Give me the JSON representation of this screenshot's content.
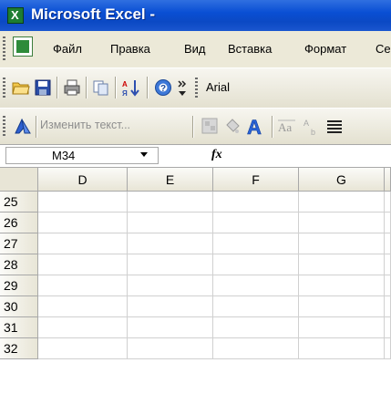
{
  "window": {
    "title": "Microsoft Excel -"
  },
  "menu": {
    "items": [
      {
        "label": "Файл"
      },
      {
        "label": "Правка"
      },
      {
        "label": "Вид"
      },
      {
        "label": "Вставка"
      },
      {
        "label": "Формат"
      },
      {
        "label": "Се"
      }
    ]
  },
  "toolbar": {
    "font": "Arial",
    "icons": [
      "open-folder-icon",
      "save-icon",
      "print-icon",
      "copy-icon",
      "sort-ascending-icon",
      "help-icon"
    ]
  },
  "toolbar2": {
    "edit_text_label": "Изменить текст..."
  },
  "formula_bar": {
    "name_box": "M34",
    "fx": "fx"
  },
  "grid": {
    "columns": [
      "D",
      "E",
      "F",
      "G"
    ],
    "rows": [
      "25",
      "26",
      "27",
      "28",
      "29",
      "30",
      "31",
      "32"
    ]
  }
}
